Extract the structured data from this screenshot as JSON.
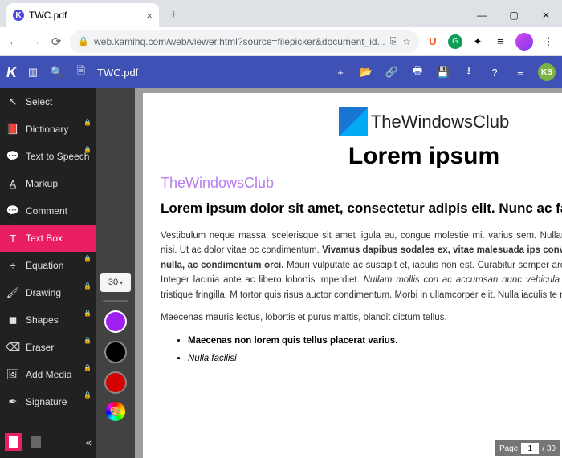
{
  "browser": {
    "tab_title": "TWC.pdf",
    "url_display": "web.kamihq.com/web/viewer.html?source=filepicker&document_id...",
    "ext_u": "U"
  },
  "kami": {
    "filename": "TWC.pdf",
    "user_initials": "KS"
  },
  "tools": {
    "select": "Select",
    "dictionary": "Dictionary",
    "tts": "Text to Speech",
    "markup": "Markup",
    "comment": "Comment",
    "textbox": "Text Box",
    "equation": "Equation",
    "drawing": "Drawing",
    "shapes": "Shapes",
    "eraser": "Eraser",
    "addmedia": "Add Media",
    "signature": "Signature"
  },
  "subpanel": {
    "size": "30",
    "colors": {
      "purple": "#a020f0",
      "black": "#000000",
      "red": "#d50000"
    }
  },
  "doc": {
    "logo_text": "TheWindowsClub",
    "h1": "Lorem ipsum",
    "watermark": "TheWindowsClub",
    "h2": "Lorem ipsum dolor sit amet, consectetur adipis elit. Nunc ac faucibus odio.",
    "p1_a": "Vestibulum neque massa, scelerisque sit amet ligula eu, congue molestie mi. ",
    "p1_b": " varius sem. Nullam at porttitor arcu, nec lacinia nisi. Ut ac dolor vitae oc",
    "p1_c": " condimentum. ",
    "p1_bold": "Vivamus dapibus sodales ex, vitae malesuada ips convallis. Maecenas sed egestas nulla, ac condimentum orci.",
    "p1_d": " Mauri vulputate ac suscipit et, iaculis non est. Curabitur semper arcu ac ligula sempe nisl blandit. Integer lacinia ante ac libero lobortis imperdiet. ",
    "p1_ital": "Nullam mollis con ac accumsan nunc vehicula vitae.",
    "p1_e": " Nulla eget justo in felis tristique fringilla. M tortor quis risus auctor condimentum. Morbi in ullamcorper elit. Nulla iaculis te mauris tempus fringilla.",
    "p2": "Maecenas mauris lectus, lobortis et purus mattis, blandit dictum tellus.",
    "li1": "Maecenas non lorem quis tellus placerat varius.",
    "li2": "Nulla facilisi"
  },
  "pageind": {
    "label": "Page",
    "current": "1",
    "total": "/ 30"
  }
}
